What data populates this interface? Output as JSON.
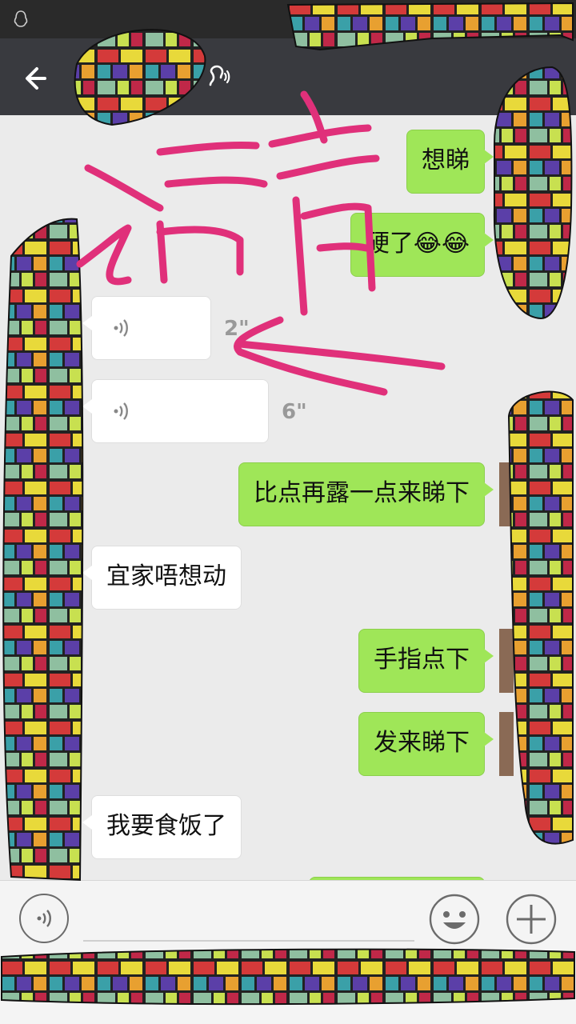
{
  "colors": {
    "status_bar": "#2a2a2a",
    "title_bar": "#393a3f",
    "chat_background": "#ebebeb",
    "outgoing_bubble": "#9fe658",
    "incoming_bubble": "#ffffff",
    "handwriting": "#e0307a"
  },
  "status_bar": {
    "icon": "qq-penguin-icon"
  },
  "title_bar": {
    "back_icon": "back-arrow-icon",
    "mode_icon": "ear-icon"
  },
  "messages": [
    {
      "direction": "out",
      "type": "text",
      "text": "想睇"
    },
    {
      "direction": "out",
      "type": "text",
      "text": "硬了",
      "emoji": "😂😂"
    },
    {
      "direction": "in",
      "type": "voice",
      "duration": "2\""
    },
    {
      "direction": "in",
      "type": "voice",
      "duration": "6\""
    },
    {
      "direction": "out",
      "type": "text",
      "text": "比点再露一点来睇下"
    },
    {
      "direction": "in",
      "type": "text",
      "text": "宜家唔想动"
    },
    {
      "direction": "out",
      "type": "text",
      "text": "手指点下"
    },
    {
      "direction": "out",
      "type": "text",
      "text": "发来睇下"
    },
    {
      "direction": "in",
      "type": "text",
      "text": "我要食饭了"
    }
  ],
  "annotation": {
    "handwritten_text": "语音"
  },
  "input_bar": {
    "voice_icon": "voice-icon",
    "emoji_icon": "smiley-icon",
    "plus_icon": "plus-icon"
  }
}
